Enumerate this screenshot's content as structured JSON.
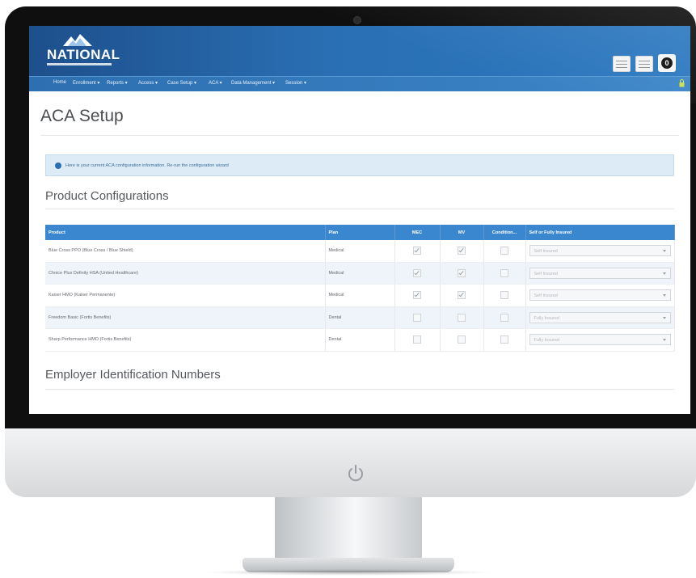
{
  "app": {
    "logo_text": "NATIONAL",
    "brand_color": "#2a6fb3"
  },
  "header_icons": [
    {
      "name": "document-icon"
    },
    {
      "name": "document-icon"
    },
    {
      "name": "notification-icon",
      "badge": "0"
    }
  ],
  "nav": {
    "items": [
      {
        "label": "Home"
      },
      {
        "label": "Enrollment ▾"
      },
      {
        "label": "Reports ▾"
      },
      {
        "label": "Access ▾"
      },
      {
        "label": "Case Setup ▾"
      },
      {
        "label": "ACA ▾"
      },
      {
        "label": "Data Management ▾"
      },
      {
        "label": "Session ▾"
      }
    ]
  },
  "page": {
    "title": "ACA Setup",
    "info_text": "Here is your current ACA configuration information. Re-run the configuration wizard"
  },
  "product_configurations": {
    "heading": "Product Configurations",
    "columns": [
      "Product",
      "Plan",
      "MEC",
      "MV",
      "Condition...",
      "Self or Fully Insured"
    ],
    "rows": [
      {
        "product": "Blue Cross PPO (Blue Cross / Blue Shield)",
        "plan": "Medical",
        "mec": true,
        "mv": true,
        "conditional": false,
        "insured": "Self Insured"
      },
      {
        "product": "Choice Plus Definity HSA (United Healthcare)",
        "plan": "Medical",
        "mec": true,
        "mv": true,
        "conditional": false,
        "insured": "Self Insured"
      },
      {
        "product": "Kaiser HMO (Kaiser Permanente)",
        "plan": "Medical",
        "mec": true,
        "mv": true,
        "conditional": false,
        "insured": "Self Insured"
      },
      {
        "product": "Freedom Basic (Fortis Benefits)",
        "plan": "Dental",
        "mec": false,
        "mv": false,
        "conditional": false,
        "insured": "Fully Insured"
      },
      {
        "product": "Sharp Performance HMO (Fortis Benefits)",
        "plan": "Dental",
        "mec": false,
        "mv": false,
        "conditional": false,
        "insured": "Fully Insured"
      }
    ]
  },
  "employer_section": {
    "heading": "Employer Identification Numbers"
  }
}
